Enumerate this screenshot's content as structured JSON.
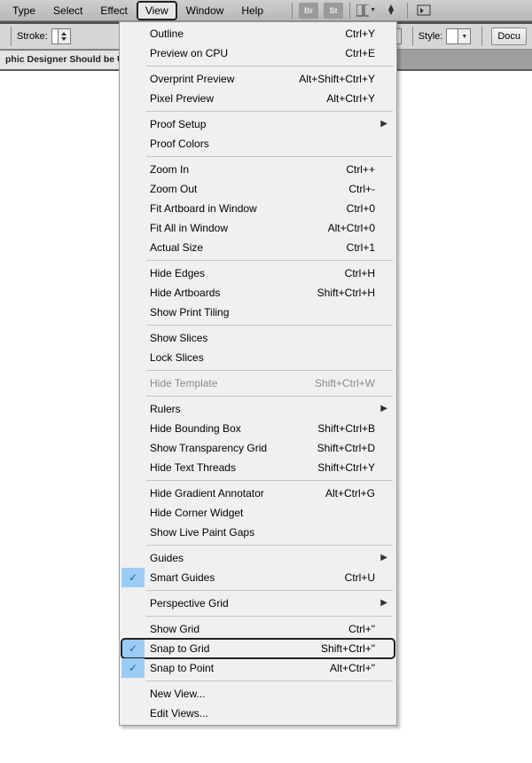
{
  "menubar": {
    "items": [
      "Type",
      "Select",
      "Effect",
      "View",
      "Window",
      "Help"
    ],
    "active_index": 3,
    "right_icons": [
      "Br",
      "St"
    ]
  },
  "optionsbar": {
    "stroke_label": "Stroke:",
    "style_label": "Style:",
    "docsetup_btn": "Docu"
  },
  "tab": {
    "title": "phic Designer Should be Us"
  },
  "menu": {
    "sections": [
      [
        {
          "label": "Outline",
          "accel": "Ctrl+Y"
        },
        {
          "label": "Preview on CPU",
          "accel": "Ctrl+E"
        }
      ],
      [
        {
          "label": "Overprint Preview",
          "accel": "Alt+Shift+Ctrl+Y"
        },
        {
          "label": "Pixel Preview",
          "accel": "Alt+Ctrl+Y"
        }
      ],
      [
        {
          "label": "Proof Setup",
          "submenu": true
        },
        {
          "label": "Proof Colors"
        }
      ],
      [
        {
          "label": "Zoom In",
          "accel": "Ctrl++"
        },
        {
          "label": "Zoom Out",
          "accel": "Ctrl+-"
        },
        {
          "label": "Fit Artboard in Window",
          "accel": "Ctrl+0"
        },
        {
          "label": "Fit All in Window",
          "accel": "Alt+Ctrl+0"
        },
        {
          "label": "Actual Size",
          "accel": "Ctrl+1"
        }
      ],
      [
        {
          "label": "Hide Edges",
          "accel": "Ctrl+H"
        },
        {
          "label": "Hide Artboards",
          "accel": "Shift+Ctrl+H"
        },
        {
          "label": "Show Print Tiling"
        }
      ],
      [
        {
          "label": "Show Slices"
        },
        {
          "label": "Lock Slices"
        }
      ],
      [
        {
          "label": "Hide Template",
          "accel": "Shift+Ctrl+W",
          "disabled": true
        }
      ],
      [
        {
          "label": "Rulers",
          "submenu": true
        },
        {
          "label": "Hide Bounding Box",
          "accel": "Shift+Ctrl+B"
        },
        {
          "label": "Show Transparency Grid",
          "accel": "Shift+Ctrl+D"
        },
        {
          "label": "Hide Text Threads",
          "accel": "Shift+Ctrl+Y"
        }
      ],
      [
        {
          "label": "Hide Gradient Annotator",
          "accel": "Alt+Ctrl+G"
        },
        {
          "label": "Hide Corner Widget"
        },
        {
          "label": "Show Live Paint Gaps"
        }
      ],
      [
        {
          "label": "Guides",
          "submenu": true
        },
        {
          "label": "Smart Guides",
          "accel": "Ctrl+U",
          "checked": true
        }
      ],
      [
        {
          "label": "Perspective Grid",
          "submenu": true
        }
      ],
      [
        {
          "label": "Show Grid",
          "accel": "Ctrl+\""
        },
        {
          "label": "Snap to Grid",
          "accel": "Shift+Ctrl+\"",
          "checked": true,
          "boxed": true
        },
        {
          "label": "Snap to Point",
          "accel": "Alt+Ctrl+\"",
          "checked": true
        }
      ],
      [
        {
          "label": "New View..."
        },
        {
          "label": "Edit Views..."
        }
      ]
    ]
  }
}
